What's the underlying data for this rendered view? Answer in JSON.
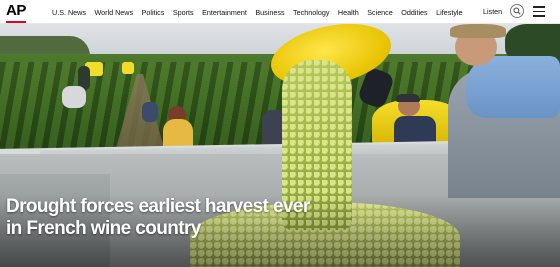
{
  "brand": {
    "logo_text": "AP",
    "accent": "#e4002b"
  },
  "nav": {
    "items": [
      "U.S. News",
      "World News",
      "Politics",
      "Sports",
      "Entertainment",
      "Business",
      "Technology",
      "Health",
      "Science",
      "Oddities",
      "Lifestyle"
    ],
    "listen_label": "Listen",
    "search_icon": "search-icon",
    "menu_icon": "hamburger-menu-icon"
  },
  "hero": {
    "headline_line1": "Drought forces earliest harvest ever",
    "headline_line2": "in French wine country"
  }
}
